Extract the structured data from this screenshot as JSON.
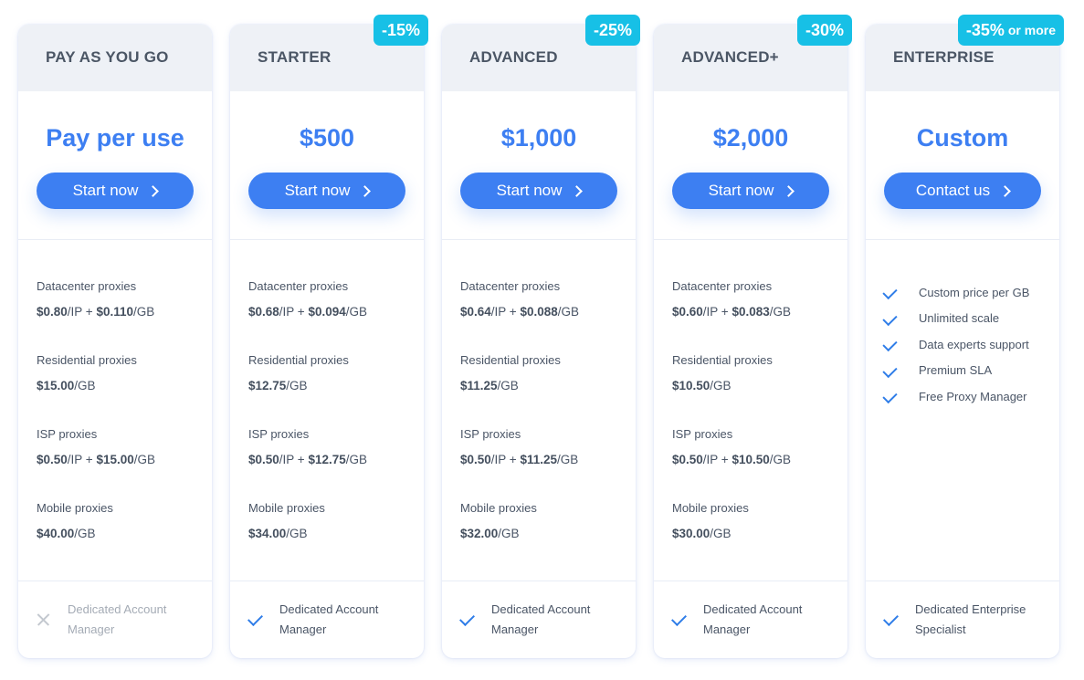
{
  "colors": {
    "accent": "#3d7ff2",
    "badge": "#17c0e6",
    "check": "#2f7de8",
    "header_bg": "#eef1f6"
  },
  "plans": [
    {
      "name": "PAY AS YOU GO",
      "badge": null,
      "price": "Pay per use",
      "cta": "Start now",
      "features": [
        {
          "label": "Datacenter proxies",
          "parts": [
            {
              "b": "$0.80"
            },
            {
              "t": "/IP + "
            },
            {
              "b": "$0.110"
            },
            {
              "t": "/GB"
            }
          ]
        },
        {
          "label": "Residential proxies",
          "parts": [
            {
              "b": "$15.00"
            },
            {
              "t": "/GB"
            }
          ]
        },
        {
          "label": "ISP proxies",
          "parts": [
            {
              "b": "$0.50"
            },
            {
              "t": "/IP + "
            },
            {
              "b": "$15.00"
            },
            {
              "t": "/GB"
            }
          ]
        },
        {
          "label": "Mobile proxies",
          "parts": [
            {
              "b": "$40.00"
            },
            {
              "t": "/GB"
            }
          ]
        }
      ],
      "bottom": {
        "icon": "cross",
        "text": "Dedicated Account Manager",
        "included": false
      }
    },
    {
      "name": "STARTER",
      "badge": {
        "text": "-15%",
        "suffix": ""
      },
      "price": "$500",
      "cta": "Start now",
      "features": [
        {
          "label": "Datacenter proxies",
          "parts": [
            {
              "b": "$0.68"
            },
            {
              "t": "/IP + "
            },
            {
              "b": "$0.094"
            },
            {
              "t": "/GB"
            }
          ]
        },
        {
          "label": "Residential proxies",
          "parts": [
            {
              "b": "$12.75"
            },
            {
              "t": "/GB"
            }
          ]
        },
        {
          "label": "ISP proxies",
          "parts": [
            {
              "b": "$0.50"
            },
            {
              "t": "/IP + "
            },
            {
              "b": "$12.75"
            },
            {
              "t": "/GB"
            }
          ]
        },
        {
          "label": "Mobile proxies",
          "parts": [
            {
              "b": "$34.00"
            },
            {
              "t": "/GB"
            }
          ]
        }
      ],
      "bottom": {
        "icon": "check",
        "text": "Dedicated Account Manager",
        "included": true
      }
    },
    {
      "name": "ADVANCED",
      "badge": {
        "text": "-25%",
        "suffix": ""
      },
      "price": "$1,000",
      "cta": "Start now",
      "features": [
        {
          "label": "Datacenter proxies",
          "parts": [
            {
              "b": "$0.64"
            },
            {
              "t": "/IP + "
            },
            {
              "b": "$0.088"
            },
            {
              "t": "/GB"
            }
          ]
        },
        {
          "label": "Residential proxies",
          "parts": [
            {
              "b": "$11.25"
            },
            {
              "t": "/GB"
            }
          ]
        },
        {
          "label": "ISP proxies",
          "parts": [
            {
              "b": "$0.50"
            },
            {
              "t": "/IP + "
            },
            {
              "b": "$11.25"
            },
            {
              "t": "/GB"
            }
          ]
        },
        {
          "label": "Mobile proxies",
          "parts": [
            {
              "b": "$32.00"
            },
            {
              "t": "/GB"
            }
          ]
        }
      ],
      "bottom": {
        "icon": "check",
        "text": "Dedicated Account Manager",
        "included": true
      }
    },
    {
      "name": "ADVANCED+",
      "badge": {
        "text": "-30%",
        "suffix": ""
      },
      "price": "$2,000",
      "cta": "Start now",
      "features": [
        {
          "label": "Datacenter proxies",
          "parts": [
            {
              "b": "$0.60"
            },
            {
              "t": "/IP + "
            },
            {
              "b": "$0.083"
            },
            {
              "t": "/GB"
            }
          ]
        },
        {
          "label": "Residential proxies",
          "parts": [
            {
              "b": "$10.50"
            },
            {
              "t": "/GB"
            }
          ]
        },
        {
          "label": "ISP proxies",
          "parts": [
            {
              "b": "$0.50"
            },
            {
              "t": "/IP + "
            },
            {
              "b": "$10.50"
            },
            {
              "t": "/GB"
            }
          ]
        },
        {
          "label": "Mobile proxies",
          "parts": [
            {
              "b": "$30.00"
            },
            {
              "t": "/GB"
            }
          ]
        }
      ],
      "bottom": {
        "icon": "check",
        "text": "Dedicated Account Manager",
        "included": true
      }
    },
    {
      "name": "ENTERPRISE",
      "badge": {
        "text": "-35%",
        "suffix": "or more"
      },
      "price": "Custom",
      "cta": "Contact us",
      "checklist": [
        "Custom price per GB",
        "Unlimited scale",
        "Data experts support",
        "Premium SLA",
        "Free Proxy Manager"
      ],
      "bottom": {
        "icon": "check",
        "text": "Dedicated Enterprise Specialist",
        "included": true
      }
    }
  ]
}
